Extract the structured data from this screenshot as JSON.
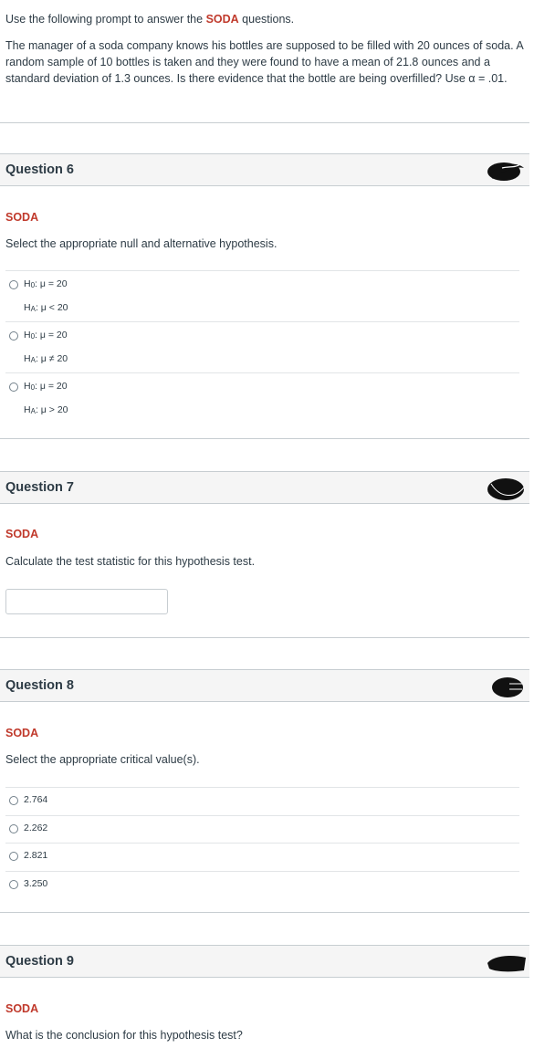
{
  "intro": {
    "line1_prefix": "Use the following prompt to answer the ",
    "line1_highlight": "SODA",
    "line1_suffix": " questions.",
    "prompt": "The manager of a soda company knows his bottles are supposed to be filled with 20 ounces of soda. A random sample of 10 bottles is taken and they were found to have a mean of 21.8 ounces and a standard deviation of 1.3 ounces. Is there evidence that the bottle are being overfilled? Use α = .01."
  },
  "questions": [
    {
      "title": "Question 6",
      "tag": "SODA",
      "text": "Select the appropriate null and alternative hypothesis.",
      "answers": [
        {
          "h0": "= 20",
          "ha": "< 20"
        },
        {
          "h0": "= 20",
          "ha": "≠ 20"
        },
        {
          "h0": "= 20",
          "ha": "> 20"
        }
      ]
    },
    {
      "title": "Question 7",
      "tag": "SODA",
      "text": "Calculate the test statistic for this hypothesis test.",
      "input_value": ""
    },
    {
      "title": "Question 8",
      "tag": "SODA",
      "text": "Select the appropriate critical value(s).",
      "answers": [
        "2.764",
        "2.262",
        "2.821",
        "3.250"
      ]
    },
    {
      "title": "Question 9",
      "tag": "SODA",
      "text": "What is the conclusion for this hypothesis test?"
    }
  ],
  "symbols": {
    "h0_prefix": "H",
    "h0_sub": "0",
    "ha_prefix": "H",
    "ha_sub": "A",
    "mu": "μ"
  },
  "colors": {
    "accent": "#c0392b",
    "text": "#2d3b45",
    "header_bg": "#f5f5f5",
    "border": "#c7cdd1"
  }
}
